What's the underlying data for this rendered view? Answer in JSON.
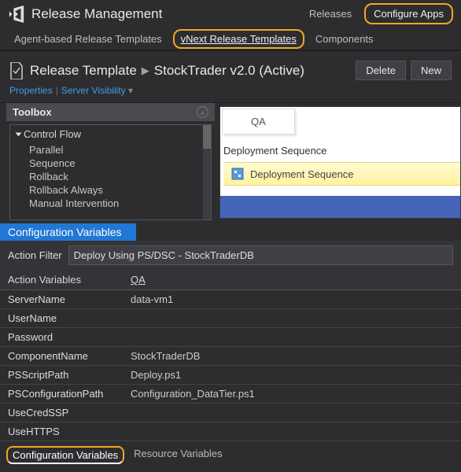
{
  "app": {
    "title": "Release Management"
  },
  "topTabs": {
    "releases": "Releases",
    "configure": "Configure Apps"
  },
  "subTabs": {
    "agent": "Agent-based Release Templates",
    "vnext": "vNext Release Templates",
    "components": "Components"
  },
  "doc": {
    "label": "Release Template",
    "name": "StockTrader v2.0 (Active)",
    "props": {
      "properties": "Properties",
      "visibility": "Server Visibility"
    },
    "actions": {
      "delete": "Delete",
      "new": "New"
    }
  },
  "toolbox": {
    "title": "Toolbox",
    "root": "Control Flow",
    "items": [
      "Parallel",
      "Sequence",
      "Rollback",
      "Rollback Always",
      "Manual Intervention"
    ]
  },
  "design": {
    "stage": "QA",
    "dsLabel": "Deployment Sequence",
    "dsRow": "Deployment Sequence"
  },
  "cvHeader": "Configuration Variables",
  "filter": {
    "label": "Action Filter",
    "value": "Deploy Using PS/DSC - StockTraderDB"
  },
  "varsHeader": {
    "col1": "Action Variables",
    "col2": "QA"
  },
  "vars": [
    {
      "name": "ServerName",
      "val": "data-vm1"
    },
    {
      "name": "UserName",
      "val": ""
    },
    {
      "name": "Password",
      "val": ""
    },
    {
      "name": "ComponentName",
      "val": "StockTraderDB"
    },
    {
      "name": "PSScriptPath",
      "val": "Deploy.ps1"
    },
    {
      "name": "PSConfigurationPath",
      "val": "Configuration_DataTier.ps1"
    },
    {
      "name": "UseCredSSP",
      "val": ""
    },
    {
      "name": "UseHTTPS",
      "val": ""
    }
  ],
  "bottomTabs": {
    "cv": "Configuration Variables",
    "rv": "Resource Variables"
  }
}
